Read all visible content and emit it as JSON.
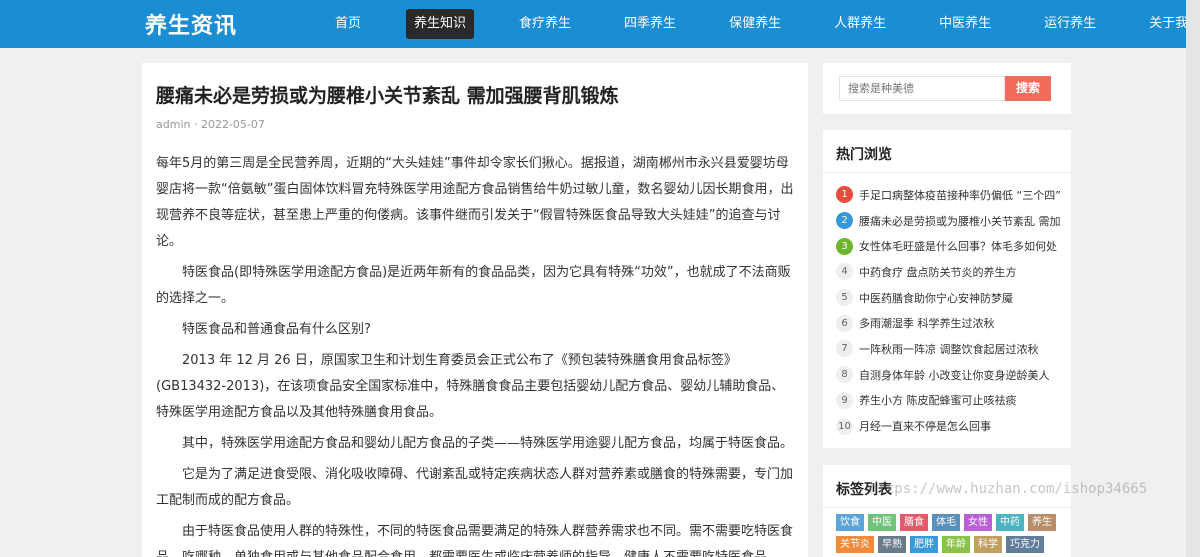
{
  "site": {
    "logo": "养生资讯"
  },
  "nav": [
    {
      "label": "首页",
      "active": false
    },
    {
      "label": "养生知识",
      "active": true
    },
    {
      "label": "食疗养生",
      "active": false
    },
    {
      "label": "四季养生",
      "active": false
    },
    {
      "label": "保健养生",
      "active": false
    },
    {
      "label": "人群养生",
      "active": false
    },
    {
      "label": "中医养生",
      "active": false
    },
    {
      "label": "运行养生",
      "active": false
    },
    {
      "label": "关于我们",
      "active": false
    }
  ],
  "article": {
    "title": "腰痛未必是劳损或为腰椎小关节紊乱 需加强腰背肌锻炼",
    "meta": "admin · 2022-05-07",
    "paragraphs": [
      "每年5月的第三周是全民营养周，近期的“大头娃娃”事件却令家长们揪心。据报道，湖南郴州市永兴县爱婴坊母婴店将一款“倍氨敏”蛋白固体饮料冒充特殊医学用途配方食品销售给牛奶过敏儿童，数名婴幼儿因长期食用，出现营养不良等症状，甚至患上严重的佝偻病。该事件继而引发关于“假冒特殊医食品导致大头娃娃”的追查与讨论。",
      "特医食品(即特殊医学用途配方食品)是近两年新有的食品品类，因为它具有特殊“功效”，也就成了不法商贩的选择之一。",
      "特医食品和普通食品有什么区别?",
      "2013 年 12 月 26 日，原国家卫生和计划生育委员会正式公布了《预包装特殊膳食用食品标签》(GB13432-2013)，在该项食品安全国家标准中，特殊膳食食品主要包括婴幼儿配方食品、婴幼儿辅助食品、特殊医学用途配方食品以及其他特殊膳食用食品。",
      "其中，特殊医学用途配方食品和婴幼儿配方食品的子类——特殊医学用途婴儿配方食品，均属于特医食品。",
      "它是为了满足进食受限、消化吸收障碍、代谢紊乱或特定疾病状态人群对营养素或膳食的特殊需要，专门加工配制而成的配方食品。",
      "由于特医食品使用人群的特殊性，不同的特医食品需要满足的特殊人群营养需求也不同。需不需要吃特医食品，吃哪种，单独食用或与其他食品配合食用，都需要医生或临床营养师的指导，健康人不需要吃特医食品。"
    ]
  },
  "search": {
    "placeholder": "搜索是种美德",
    "button": "搜索"
  },
  "hot": {
    "title": "热门浏览",
    "items": [
      {
        "rank": "1",
        "text": "手足口病整体疫苗接种率仍偏低 “三个四”"
      },
      {
        "rank": "2",
        "text": "腰痛未必是劳损或为腰椎小关节紊乱 需加"
      },
      {
        "rank": "3",
        "text": "女性体毛旺盛是什么回事？体毛多如何处"
      },
      {
        "rank": "4",
        "text": "中药食疗 盘点防关节炎的养生方"
      },
      {
        "rank": "5",
        "text": "中医药膳食助你宁心安神防梦魇"
      },
      {
        "rank": "6",
        "text": "多雨潮湿季 科学养生过浓秋"
      },
      {
        "rank": "7",
        "text": "一阵秋雨一阵凉 调整饮食起居过浓秋"
      },
      {
        "rank": "8",
        "text": "自测身体年龄 小改变让你变身逆龄美人"
      },
      {
        "rank": "9",
        "text": "养生小方 陈皮配蜂蜜可止咳祛痰"
      },
      {
        "rank": "10",
        "text": "月经一直来不停是怎么回事"
      }
    ]
  },
  "tags": {
    "title": "标签列表",
    "items": [
      {
        "label": "饮食",
        "color": "#5da4d9"
      },
      {
        "label": "中医",
        "color": "#6fc47a"
      },
      {
        "label": "膳食",
        "color": "#e8586b"
      },
      {
        "label": "体毛",
        "color": "#5b8fb9"
      },
      {
        "label": "女性",
        "color": "#b85fd6"
      },
      {
        "label": "中药",
        "color": "#4bb3c1"
      },
      {
        "label": "养生",
        "color": "#b98e6b"
      },
      {
        "label": "关节炎",
        "color": "#f08b3c"
      },
      {
        "label": "早熟",
        "color": "#6a7b8c"
      },
      {
        "label": "肥胖",
        "color": "#3a9ad9"
      },
      {
        "label": "年龄",
        "color": "#8bc34a"
      },
      {
        "label": "科学",
        "color": "#c0a060"
      },
      {
        "label": "巧克力",
        "color": "#607d9b"
      }
    ]
  },
  "watermark": "https://www.huzhan.com/ishop34665"
}
